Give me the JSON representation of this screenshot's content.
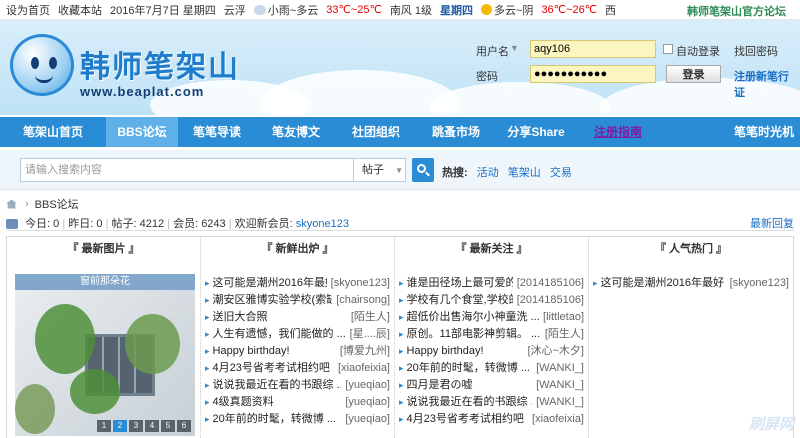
{
  "topbar": {
    "set_home": "设为首页",
    "bookmark": "收藏本站",
    "date": "2016年7月7日 星期四",
    "place": "云浮",
    "weather1": "小雨~多云",
    "temp1": "33℃~25℃",
    "wind": "南风 1级",
    "day2": "星期四",
    "weather2": "多云~阴",
    "temp2": "36℃~26℃",
    "place2": "西",
    "official": "韩师笔架山官方论坛"
  },
  "header": {
    "logo_text": "韩师笔架山",
    "logo_url": "www.beaplat.com"
  },
  "login": {
    "username_label": "用户名",
    "username_value": "aqy106",
    "password_label": "密码",
    "password_value": "●●●●●●●●●●●",
    "auto_login": "自动登录",
    "find_password": "找回密码",
    "login_button": "登录",
    "register": "注册新笔行证"
  },
  "nav": {
    "items": [
      "笔架山首页",
      "BBS论坛",
      "笔笔导读",
      "笔友博文",
      "社团组织",
      "跳蚤市场",
      "分享Share",
      "注册指南"
    ],
    "right": "笔笔时光机"
  },
  "search": {
    "placeholder": "请输入搜索内容",
    "type": "帖子",
    "hot_label": "热搜:",
    "hot_items": [
      "活动",
      "笔架山",
      "交易"
    ]
  },
  "breadcrumb": {
    "label": "BBS论坛"
  },
  "stats": {
    "today": "今日: 0",
    "yesterday": "昨日: 0",
    "posts": "帖子: 4212",
    "members": "会员: 6243",
    "welcome": "欢迎新会员:",
    "new_member": "skyone123",
    "latest": "最新回复"
  },
  "panels": {
    "images": {
      "title": "『 最新图片 』",
      "caption": "窗前那朵花",
      "pages": [
        "1",
        "2",
        "3",
        "4",
        "5",
        "6"
      ]
    },
    "fresh": {
      "title": "『 新鲜出炉 』",
      "items": [
        {
          "t": "这可能是潮州2016年最好 ...",
          "a": "[skyone123]"
        },
        {
          "t": "潮安区雅博实验学校(索缺 ...",
          "a": "[chairsong]"
        },
        {
          "t": "送旧大合照",
          "a": "[陌生人]"
        },
        {
          "t": "人生有遗憾，我们能做的 ...",
          "a": "[星....辰]"
        },
        {
          "t": "Happy birthday!",
          "a": "[博爱九州]"
        },
        {
          "t": "4月23号省考考试相约吧 ...",
          "a": "[xiaofeixia]"
        },
        {
          "t": "说说我最近在看的书跟综 ...",
          "a": "[yueqiao]"
        },
        {
          "t": "4级真题资料",
          "a": "[yueqiao]"
        },
        {
          "t": "20年前的时髦，转微博 ...",
          "a": "[yueqiao]"
        }
      ]
    },
    "focus": {
      "title": "『 最新关注 』",
      "items": [
        {
          "t": "谁是田径场上最可爱的人",
          "a": "[2014185106]"
        },
        {
          "t": "学校有几个食堂,学校的食",
          "a": "[2014185106]"
        },
        {
          "t": "超低价出售海尔小神童洗 ...",
          "a": "[littletao]"
        },
        {
          "t": "原创。11部电影神剪辑。 ...",
          "a": "[陌生人]"
        },
        {
          "t": "Happy birthday!",
          "a": "[沐心~木夕]"
        },
        {
          "t": "20年前的时髦，转微博 ...",
          "a": "[WANKI_]"
        },
        {
          "t": "四月是君の嘘",
          "a": "[WANKI_]"
        },
        {
          "t": "说说我最近在看的书跟综 ...",
          "a": "[WANKI_]"
        },
        {
          "t": "4月23号省考考试相约吧 ...",
          "a": "[xiaofeixia]"
        }
      ]
    },
    "popular": {
      "title": "『 人气热门 』",
      "items": [
        {
          "t": "这可能是潮州2016年最好 ...",
          "a": "[skyone123]"
        }
      ]
    }
  },
  "watermark": "刷屏网"
}
